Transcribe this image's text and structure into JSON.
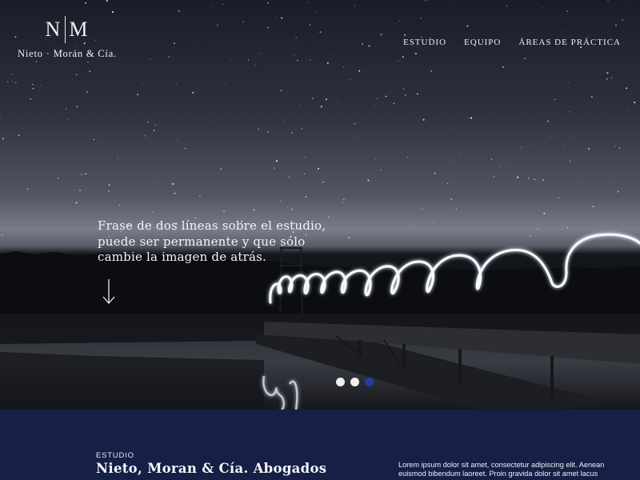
{
  "logo": {
    "left_letter": "N",
    "right_letter": "M",
    "name": "Nieto · Morán & Cía."
  },
  "nav": {
    "items": [
      {
        "label": "ESTUDIO"
      },
      {
        "label": "EQUIPO"
      },
      {
        "label": "ÁREAS DE PRÁCTICA"
      }
    ]
  },
  "hero": {
    "tagline": "Frase de dos líneas sobre el estudio, puede ser permanente y que sólo cambie la imagen de atrás.",
    "slider": {
      "count": 3,
      "active_index": 2
    }
  },
  "about": {
    "eyebrow": "ESTUDIO",
    "title": "Nieto, Moran & Cía. Abogados",
    "body": "Lorem ipsum dolor sit amet, consectetur adipiscing elit. Aenean euismod bibendum laoreet. Proin gravida dolor sit amet lacus"
  },
  "colors": {
    "section_bg": "#161f45",
    "active_dot": "#1f3fa6",
    "text": "#f0f0f0"
  },
  "icons": {
    "scroll": "arrow-down-icon"
  }
}
